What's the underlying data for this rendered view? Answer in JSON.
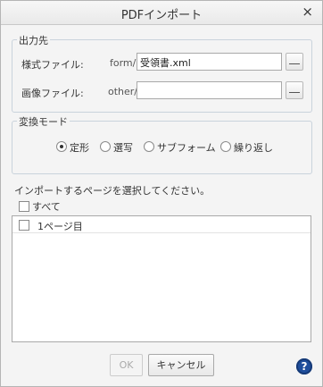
{
  "dialog": {
    "title": "PDFインポート",
    "close_symbol": "×"
  },
  "output": {
    "legend": "出力先",
    "form_label": "様式ファイル:",
    "form_prefix": "form/",
    "form_value": "受領書.xml",
    "image_label": "画像ファイル:",
    "image_prefix": "other/",
    "image_value": ""
  },
  "mode": {
    "legend": "変換モード",
    "options": [
      {
        "label": "定形",
        "selected": true
      },
      {
        "label": "選写",
        "selected": false
      },
      {
        "label": "サブフォーム",
        "selected": false
      },
      {
        "label": "繰り返し",
        "selected": false
      }
    ]
  },
  "pages": {
    "instruction": "インポートするページを選択してください。",
    "select_all_label": "すべて",
    "select_all_checked": false,
    "items": [
      {
        "label": "1ページ目",
        "checked": false
      }
    ]
  },
  "buttons": {
    "ok_label": "OK",
    "ok_enabled": false,
    "cancel_label": "キャンセル",
    "help_symbol": "?"
  },
  "icons": {
    "close": "close-icon",
    "browse": "ellipsis-icon",
    "help": "help-icon"
  }
}
